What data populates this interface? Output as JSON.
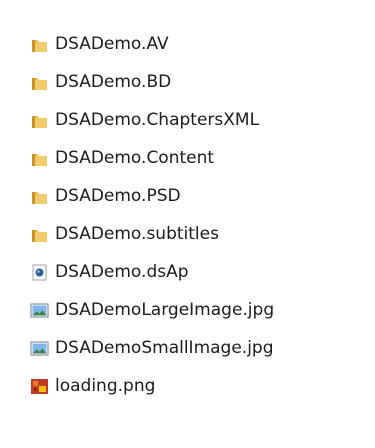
{
  "files": [
    {
      "name": "DSADemo.AV",
      "icon": "folder-icon"
    },
    {
      "name": "DSADemo.BD",
      "icon": "folder-icon"
    },
    {
      "name": "DSADemo.ChaptersXML",
      "icon": "folder-icon"
    },
    {
      "name": "DSADemo.Content",
      "icon": "folder-icon"
    },
    {
      "name": "DSADemo.PSD",
      "icon": "folder-icon"
    },
    {
      "name": "DSADemo.subtitles",
      "icon": "folder-icon"
    },
    {
      "name": "DSADemo.dsAp",
      "icon": "dsap-file-icon"
    },
    {
      "name": "DSADemoLargeImage.jpg",
      "icon": "jpg-image-icon"
    },
    {
      "name": "DSADemoSmallImage.jpg",
      "icon": "jpg-image-icon"
    },
    {
      "name": "loading.png",
      "icon": "png-image-icon"
    }
  ],
  "colors": {
    "folder": "#e8b94a",
    "folder_dark": "#c9922a",
    "text": "#1b1b1b"
  }
}
